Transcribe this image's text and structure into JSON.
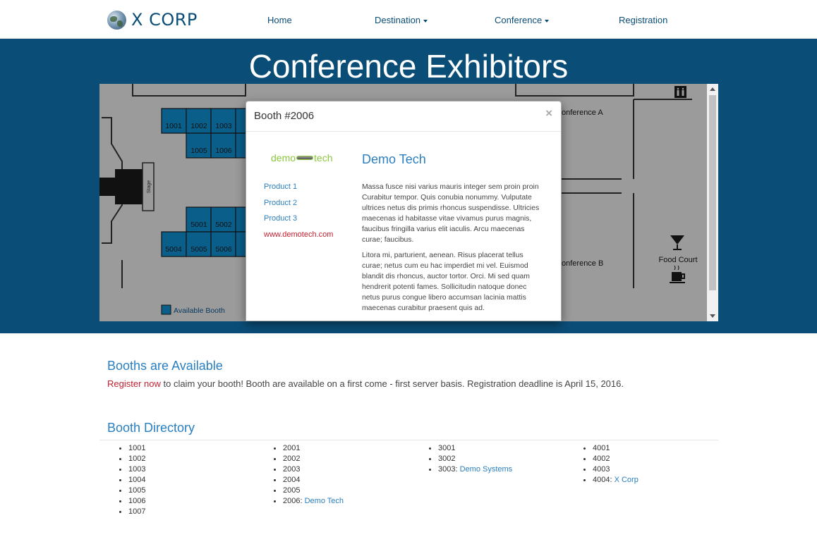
{
  "nav": {
    "brand": "X CORP",
    "items": [
      {
        "label": "Home",
        "dropdown": false
      },
      {
        "label": "Destination",
        "dropdown": true
      },
      {
        "label": "Conference",
        "dropdown": true
      },
      {
        "label": "Registration",
        "dropdown": false
      }
    ]
  },
  "hero": {
    "title": "Conference Exhibitors"
  },
  "map": {
    "booths_row1": [
      "1001",
      "1002",
      "1003"
    ],
    "booths_row2": [
      "1005",
      "1006"
    ],
    "booths_row3": [
      "5001",
      "5002"
    ],
    "booths_row4": [
      "5004",
      "5005",
      "5006"
    ],
    "stage_label": "Stage",
    "room_a": "onference A",
    "room_b": "onference B",
    "food_court": "Food Court",
    "legend_label": "Available Booth",
    "colors": {
      "booth": "#0a5e8a",
      "floor": "#9b9b9b"
    }
  },
  "modal": {
    "title": "Booth #2006",
    "logo_left": "demo",
    "logo_right": "tech",
    "company": "Demo Tech",
    "links": [
      "Product 1",
      "Product 2",
      "Product 3"
    ],
    "website": "www.demotech.com",
    "desc1": "Massa fusce nisi varius mauris integer sem proin proin Curabitur tempor. Quis conubia nonummy. Vulputate ultrices netus dis primis rhoncus suspendisse. Ultricies maecenas id habitasse vitae vivamus purus magnis, faucibus fringilla varius elit iaculis. Arcu maecenas curae; faucibus.",
    "desc2": "Litora mi, parturient, aenean. Risus placerat tellus curae; netus cum eu hac imperdiet mi vel. Euismod blandit dis rhoncus, auctor tortor. Orci. Mi sed quam hendrerit potenti fames. Sollicitudin natoque donec netus purus congue libero accumsan lacinia mattis maecenas curabitur praesent quis ad."
  },
  "booths_section": {
    "heading": "Booths are Available",
    "register_link": "Register now",
    "text": " to claim your booth! Booth are available on a first come - first server basis. Registration deadline is April 15, 2016."
  },
  "directory": {
    "heading": "Booth Directory",
    "columns": [
      [
        {
          "id": "1001"
        },
        {
          "id": "1002"
        },
        {
          "id": "1003"
        },
        {
          "id": "1004"
        },
        {
          "id": "1005"
        },
        {
          "id": "1006"
        },
        {
          "id": "1007"
        }
      ],
      [
        {
          "id": "2001"
        },
        {
          "id": "2002"
        },
        {
          "id": "2003"
        },
        {
          "id": "2004"
        },
        {
          "id": "2005"
        },
        {
          "id": "2006:",
          "company": "Demo Tech"
        }
      ],
      [
        {
          "id": "3001"
        },
        {
          "id": "3002"
        },
        {
          "id": "3003:",
          "company": "Demo Systems"
        }
      ],
      [
        {
          "id": "4001"
        },
        {
          "id": "4002"
        },
        {
          "id": "4003"
        },
        {
          "id": "4004:",
          "company": "X Corp"
        }
      ]
    ]
  }
}
